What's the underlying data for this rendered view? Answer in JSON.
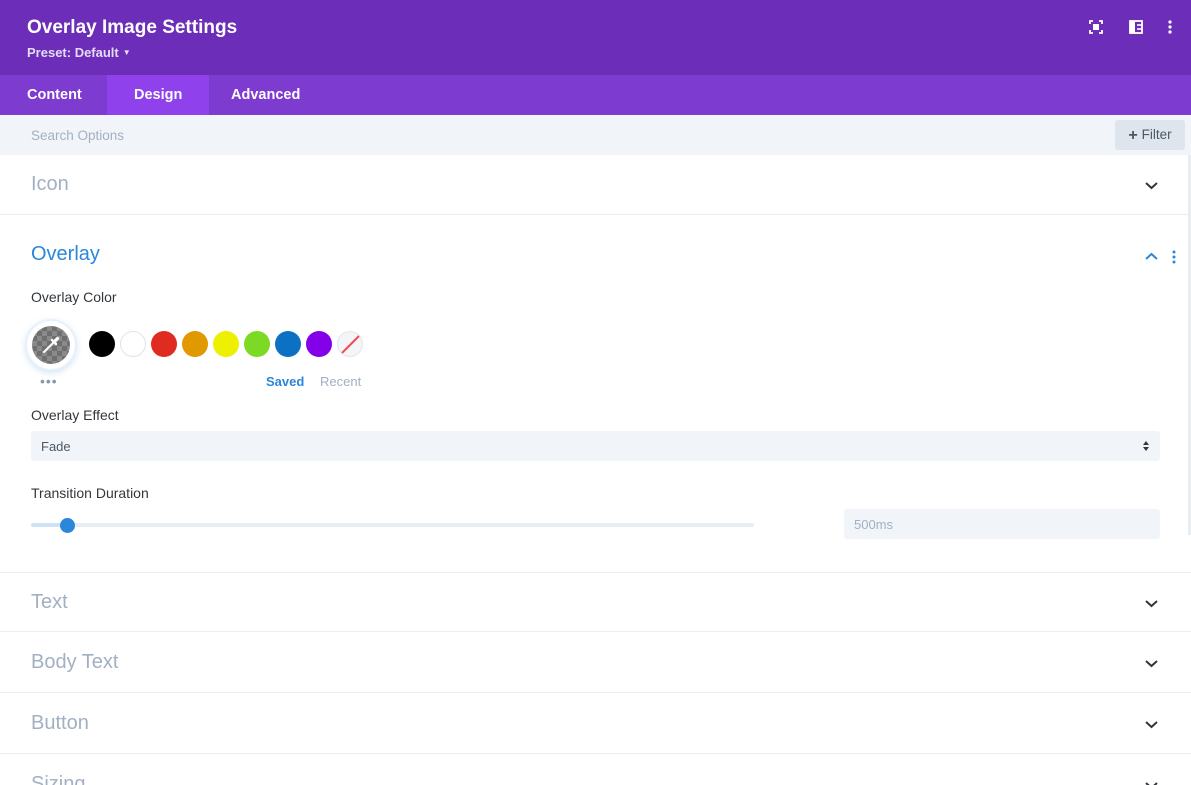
{
  "header": {
    "title": "Overlay Image Settings",
    "preset_label": "Preset: Default",
    "icons": [
      "focus-icon",
      "split-view-icon",
      "more-vertical-icon"
    ]
  },
  "tabs": [
    {
      "label": "Content",
      "active": false
    },
    {
      "label": "Design",
      "active": true
    },
    {
      "label": "Advanced",
      "active": false
    }
  ],
  "search": {
    "placeholder": "Search Options",
    "value": ""
  },
  "filter": {
    "label": "Filter"
  },
  "sections": {
    "icon": {
      "title": "Icon",
      "expanded": false
    },
    "overlay": {
      "title": "Overlay",
      "expanded": true,
      "overlay_color": {
        "label": "Overlay Color",
        "swatches": [
          "#000000",
          "#ffffff",
          "#e02b20",
          "#e09900",
          "#edf000",
          "#7cda24",
          "#0c71c3",
          "#8300e9"
        ],
        "tabs": {
          "saved": "Saved",
          "recent": "Recent"
        }
      },
      "overlay_effect": {
        "label": "Overlay Effect",
        "value": "Fade"
      },
      "transition_duration": {
        "label": "Transition Duration",
        "value": "500ms",
        "slider_fraction": 0.05
      }
    },
    "text": {
      "title": "Text",
      "expanded": false
    },
    "body_text": {
      "title": "Body Text",
      "expanded": false
    },
    "button": {
      "title": "Button",
      "expanded": false
    },
    "sizing": {
      "title": "Sizing",
      "expanded": false
    }
  },
  "colors": {
    "header_bg": "#6c2eb9",
    "tab_bar_bg": "#7e3bd0",
    "active_tab_bg": "#8f42ec",
    "accent": "#2b87da"
  }
}
